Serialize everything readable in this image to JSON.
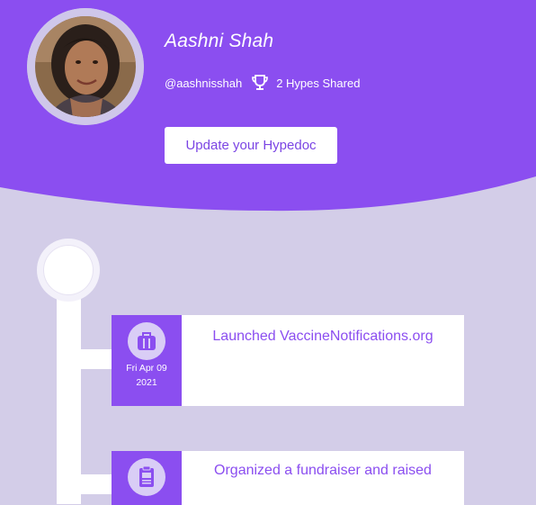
{
  "profile": {
    "name": "Aashni Shah",
    "handle": "@aashnisshah",
    "hypes_shared": "2 Hypes Shared",
    "update_button": "Update your Hypedoc",
    "avatar_icon": "profile-photo"
  },
  "timeline": {
    "items": [
      {
        "icon": "briefcase-icon",
        "date_line1": "Fri Apr 09",
        "date_line2": "2021",
        "title": "Launched VaccineNotifications.org"
      },
      {
        "icon": "clipboard-icon",
        "date_line1": "",
        "date_line2": "",
        "title": "Organized a fundraiser and raised"
      }
    ]
  },
  "colors": {
    "header_purple": "#8b4ef0",
    "page_background": "#d3cde8",
    "accent_text": "#8b4ef0"
  }
}
